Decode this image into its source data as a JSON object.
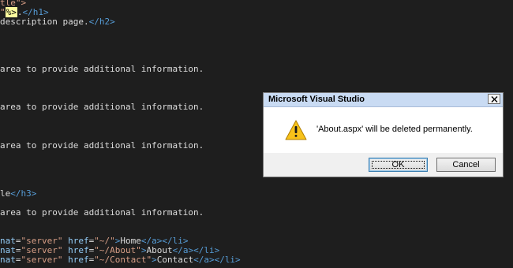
{
  "editor": {
    "lines": [
      [
        {
          "t": "tle\">",
          "c": "tok-str"
        }
      ],
      [
        {
          "t": "\"",
          "c": "tok-str"
        },
        {
          "t": "%>",
          "c": "tok-aspx"
        },
        {
          "t": ".",
          "c": "tok-text"
        },
        {
          "t": "</h1>",
          "c": "tok-tag"
        }
      ],
      [
        {
          "t": "description page.",
          "c": "tok-text"
        },
        {
          "t": "</h2>",
          "c": "tok-tag"
        }
      ],
      [
        {
          "t": "area to provide additional information.",
          "c": "tok-text"
        }
      ],
      [
        {
          "t": "area to provide additional information.",
          "c": "tok-text"
        }
      ],
      [
        {
          "t": "area to provide additional information.",
          "c": "tok-text"
        }
      ],
      [
        {
          "t": "le",
          "c": "tok-text"
        },
        {
          "t": "</h3>",
          "c": "tok-tag"
        }
      ],
      [
        {
          "t": "area to provide additional information.",
          "c": "tok-text"
        }
      ],
      [
        {
          "t": "nat",
          "c": "tok-attr"
        },
        {
          "t": "=",
          "c": "tok-text"
        },
        {
          "t": "\"server\"",
          "c": "tok-str"
        },
        {
          "t": " ",
          "c": "tok-text"
        },
        {
          "t": "href",
          "c": "tok-attr"
        },
        {
          "t": "=",
          "c": "tok-text"
        },
        {
          "t": "\"~/\"",
          "c": "tok-str"
        },
        {
          "t": ">",
          "c": "tok-tag"
        },
        {
          "t": "Home",
          "c": "tok-text"
        },
        {
          "t": "</a></li>",
          "c": "tok-tag"
        }
      ],
      [
        {
          "t": "nat",
          "c": "tok-attr"
        },
        {
          "t": "=",
          "c": "tok-text"
        },
        {
          "t": "\"server\"",
          "c": "tok-str"
        },
        {
          "t": " ",
          "c": "tok-text"
        },
        {
          "t": "href",
          "c": "tok-attr"
        },
        {
          "t": "=",
          "c": "tok-text"
        },
        {
          "t": "\"~/About\"",
          "c": "tok-str"
        },
        {
          "t": ">",
          "c": "tok-tag"
        },
        {
          "t": "About",
          "c": "tok-text"
        },
        {
          "t": "</a></li>",
          "c": "tok-tag"
        }
      ],
      [
        {
          "t": "nat",
          "c": "tok-attr"
        },
        {
          "t": "=",
          "c": "tok-text"
        },
        {
          "t": "\"server\"",
          "c": "tok-str"
        },
        {
          "t": " ",
          "c": "tok-text"
        },
        {
          "t": "href",
          "c": "tok-attr"
        },
        {
          "t": "=",
          "c": "tok-text"
        },
        {
          "t": "\"~/Contact\"",
          "c": "tok-str"
        },
        {
          "t": ">",
          "c": "tok-tag"
        },
        {
          "t": "Contact",
          "c": "tok-text"
        },
        {
          "t": "</a></li>",
          "c": "tok-tag"
        }
      ]
    ]
  },
  "dialog": {
    "title": "Microsoft Visual Studio",
    "icon": "warning-icon",
    "message": "'About.aspx' will be deleted permanently.",
    "ok_label": "OK",
    "cancel_label": "Cancel",
    "close_icon": "close-icon"
  },
  "colors": {
    "editor_background": "#1e1e1e",
    "dialog_titlebar": "#c9dbf3",
    "warning_yellow": "#f7c21a"
  }
}
